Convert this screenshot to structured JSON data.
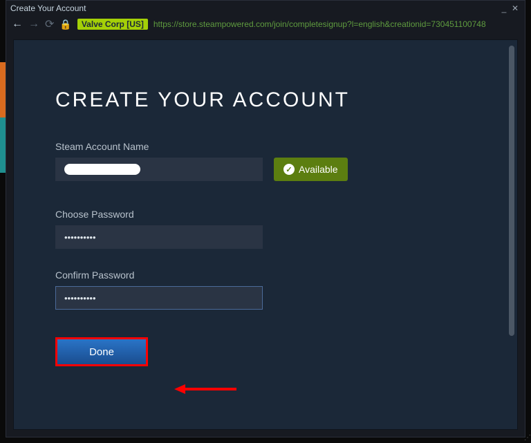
{
  "window": {
    "title": "Create Your Account",
    "minimize": "_",
    "close": "✕"
  },
  "addressbar": {
    "cert": "Valve Corp [US]",
    "url": "https://store.steampowered.com/join/completesignup?l=english&creationid=730451100748"
  },
  "page": {
    "heading": "CREATE YOUR ACCOUNT",
    "account_name": {
      "label": "Steam Account Name",
      "value": ""
    },
    "availability": {
      "text": "Available"
    },
    "password": {
      "label": "Choose Password",
      "value": "••••••••••"
    },
    "confirm": {
      "label": "Confirm Password",
      "value": "••••••••••"
    },
    "done": "Done"
  }
}
